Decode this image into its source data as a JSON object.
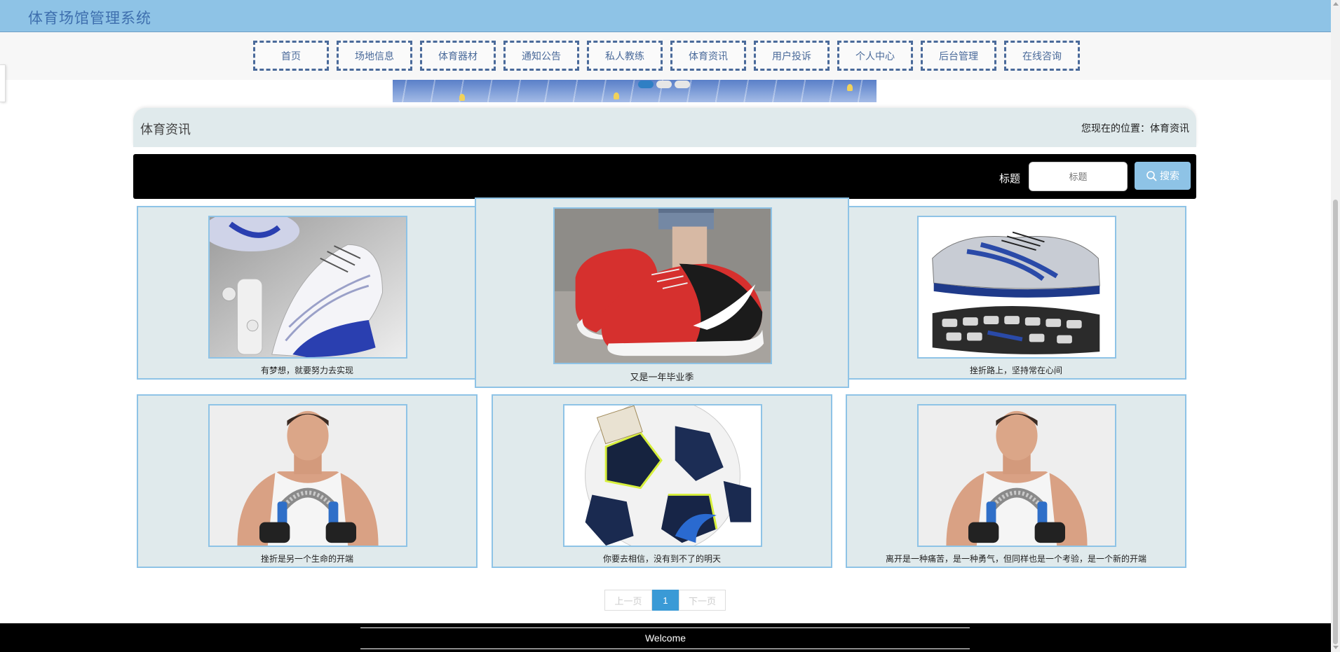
{
  "app": {
    "title": "体育场馆管理系统"
  },
  "nav": {
    "items": [
      "首页",
      "场地信息",
      "体育器材",
      "通知公告",
      "私人教练",
      "体育资讯",
      "用户投诉",
      "个人中心",
      "后台管理",
      "在线咨询"
    ]
  },
  "banner": {
    "active_dot": 1,
    "dot_count": 3
  },
  "section": {
    "title": "体育资讯",
    "location": "您现在的位置：体育资讯"
  },
  "search": {
    "label": "标题",
    "placeholder": "标题",
    "button_label": "搜索",
    "icon": "search-icon"
  },
  "articles": [
    {
      "caption": "有梦想，就要努力去实现",
      "image": "basketball-shoe-image"
    },
    {
      "caption": "又是一年毕业季",
      "image": "red-running-shoe-image"
    },
    {
      "caption": "挫折路上，坚持常在心间",
      "image": "running-shoe-pair-image"
    },
    {
      "caption": "挫折是另一个生命的开端",
      "image": "fitness-man-image"
    },
    {
      "caption": "你要去相信，没有到不了的明天",
      "image": "soccer-ball-image"
    },
    {
      "caption": "离开是一种痛苦，是一种勇气，但同样也是一个考验，是一个新的开端",
      "image": "fitness-man-image"
    }
  ],
  "pagination": {
    "prev": "上一页",
    "current": "1",
    "next": "下一页"
  },
  "footer": {
    "text": "Welcome"
  },
  "colors": {
    "header_bg": "#8ec3e6",
    "card_bg": "#e0eaec",
    "accent": "#3a9ad6",
    "nav_border": "#4a6a9a"
  }
}
